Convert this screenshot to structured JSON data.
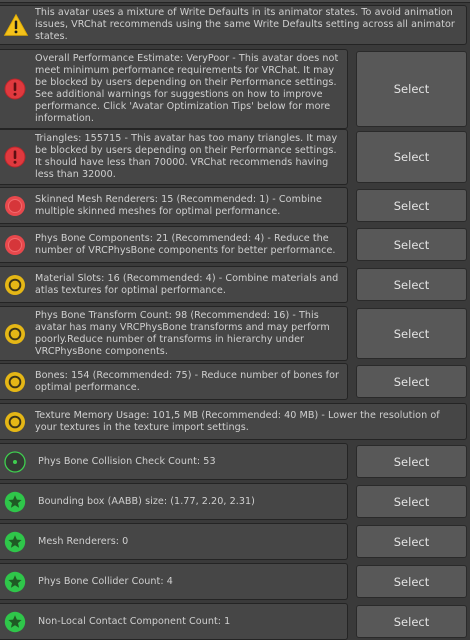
{
  "write_defaults_warning": "This avatar uses a mixture of Write Defaults in its animator states. To avoid animation issues, VRChat recommends using the same Write Defaults setting across all animator states.",
  "select_label": "Select",
  "checks": [
    {
      "severity": "error",
      "icon": "exclamation-error-icon",
      "has_button": true,
      "message": "Overall Performance Estimate: VeryPoor - This avatar does not meet minimum performance requirements for VRChat. It may be blocked by users depending on their Performance settings. See additional warnings for suggestions on how to improve performance. Click 'Avatar Optimization Tips' below for more information."
    },
    {
      "severity": "error",
      "icon": "exclamation-error-icon",
      "has_button": true,
      "message": "Triangles: 155715 - This avatar has too many triangles. It may be blocked by users depending on their Performance settings. It should have less than 70000. VRChat recommends having less than 32000."
    },
    {
      "severity": "very-poor",
      "icon": "red-circle-icon",
      "has_button": true,
      "message": "Skinned Mesh Renderers: 15 (Recommended: 1) - Combine multiple skinned meshes for optimal performance."
    },
    {
      "severity": "very-poor",
      "icon": "red-circle-icon",
      "has_button": true,
      "message": "Phys Bone Components: 21 (Recommended: 4) - Reduce the number of VRCPhysBone components for better performance."
    },
    {
      "severity": "poor",
      "icon": "yellow-circle-icon",
      "has_button": true,
      "message": "Material Slots: 16 (Recommended: 4) - Combine materials and atlas textures for optimal performance."
    },
    {
      "severity": "poor",
      "icon": "yellow-circle-icon",
      "has_button": true,
      "message": "Phys Bone Transform Count: 98 (Recommended: 16) - This avatar has many VRCPhysBone transforms and may perform poorly.Reduce number of transforms in hierarchy under VRCPhysBone components."
    },
    {
      "severity": "poor",
      "icon": "yellow-circle-icon",
      "has_button": true,
      "message": "Bones: 154 (Recommended: 75) - Reduce number of bones for optimal performance."
    },
    {
      "severity": "poor",
      "icon": "yellow-circle-icon",
      "has_button": false,
      "message": "Texture Memory Usage: 101,5 MB (Recommended: 40 MB) - Lower the resolution of your textures in the texture import settings."
    },
    {
      "severity": "good",
      "icon": "green-dot-icon",
      "has_button": true,
      "message": "Phys Bone Collision Check Count: 53"
    },
    {
      "severity": "excellent",
      "icon": "green-star-icon",
      "has_button": true,
      "message": "Bounding box (AABB) size: (1.77, 2.20, 2.31)"
    },
    {
      "severity": "excellent",
      "icon": "green-star-icon",
      "has_button": true,
      "message": "Mesh Renderers: 0"
    },
    {
      "severity": "excellent",
      "icon": "green-star-icon",
      "has_button": true,
      "message": "Phys Bone Collider Count: 4"
    },
    {
      "severity": "excellent",
      "icon": "green-star-icon",
      "has_button": true,
      "message": "Non-Local Contact Component Count: 1"
    }
  ]
}
